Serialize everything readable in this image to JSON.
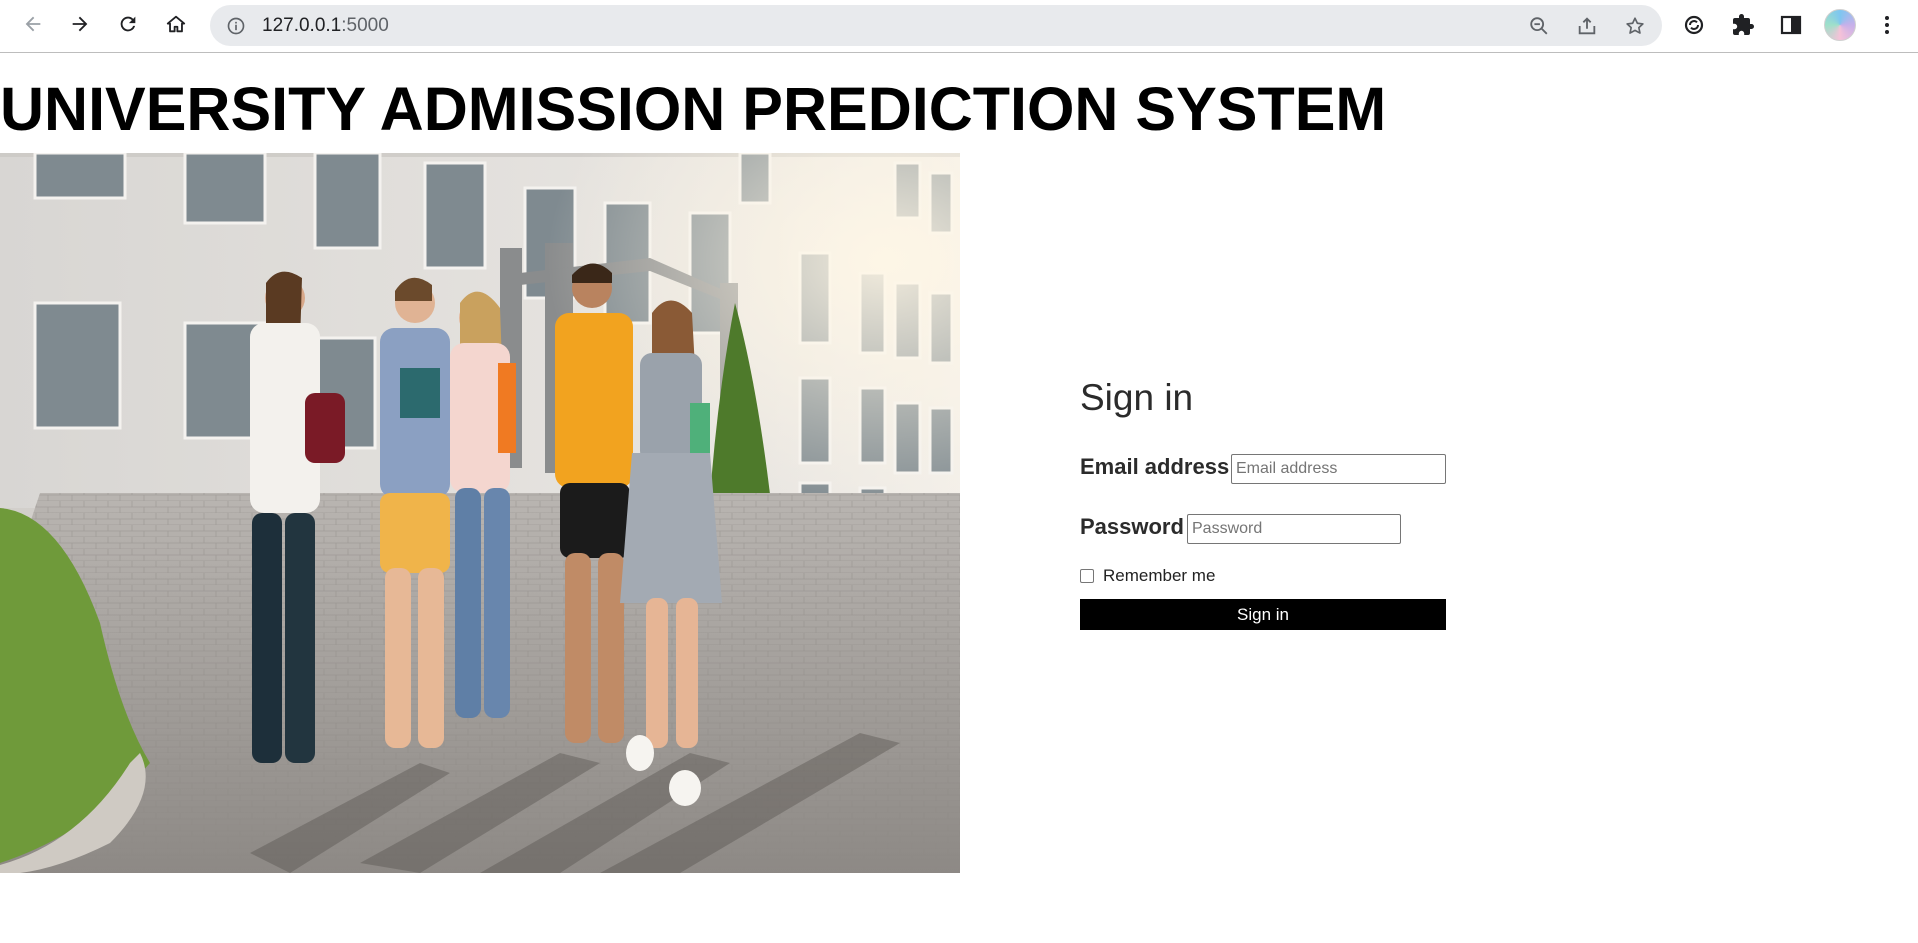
{
  "browser": {
    "url_host": "127.0.0.1",
    "url_port": ":5000"
  },
  "page": {
    "title": "UNIVERSITY ADMISSION PREDICTION SYSTEM",
    "hero_alt": "Students walking outside university building"
  },
  "signin": {
    "heading": "Sign in",
    "email_label": "Email address",
    "email_placeholder": "Email address",
    "password_label": "Password",
    "password_placeholder": "Password",
    "remember_label": "Remember me",
    "submit_label": "Sign in"
  },
  "colors": {
    "button_bg": "#000000",
    "button_text": "#ffffff",
    "title": "#000000",
    "chrome_bar": "#e8eaed"
  }
}
